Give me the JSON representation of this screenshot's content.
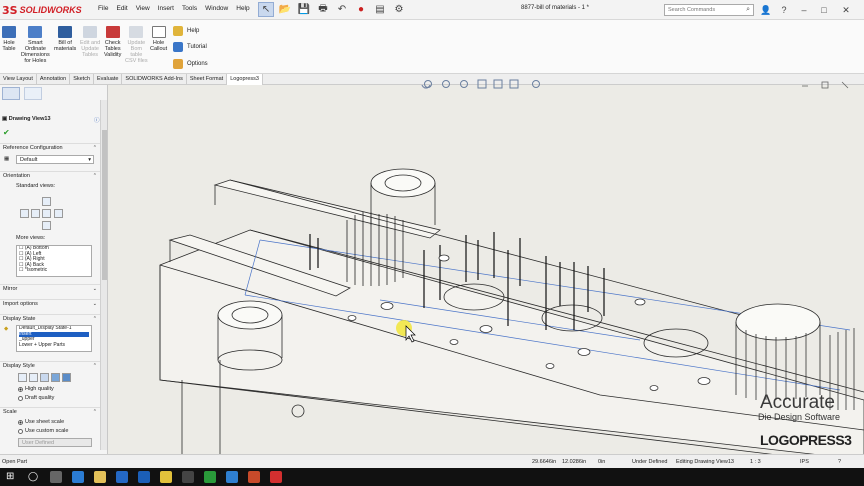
{
  "app": {
    "logo_mark": "3S",
    "logo_text": "SOLIDWORKS",
    "doc_title": "8877-bill of materials - 1 *"
  },
  "menu": [
    "File",
    "Edit",
    "View",
    "Insert",
    "Tools",
    "Window",
    "Help"
  ],
  "search": {
    "placeholder": "Search Commands"
  },
  "ribbon": {
    "buttons": [
      {
        "label": "Hole\nTable",
        "enabled": true
      },
      {
        "label": "Smart\nOrdinate\nDimensions\nfor Holes",
        "enabled": true
      },
      {
        "label": "Bill of\nmaterials",
        "enabled": true
      },
      {
        "label": "Edit and\nUpdate\nTables",
        "enabled": false
      },
      {
        "label": "Check\nTables\nValidity",
        "enabled": true
      },
      {
        "label": "Update\nBom\ntable\nCSV files",
        "enabled": false
      },
      {
        "label": "Hole\nCallout",
        "enabled": true
      }
    ],
    "side": [
      "Help",
      "Tutorial",
      "Options"
    ]
  },
  "tabs": [
    "View Layout",
    "Annotation",
    "Sketch",
    "Evaluate",
    "SOLIDWORKS Add-Ins",
    "Sheet Format",
    "Logopress3"
  ],
  "active_tab": "Logopress3",
  "panel": {
    "title": "Drawing View13",
    "ref_config": {
      "header": "Reference Configuration",
      "value": "Default"
    },
    "orientation": {
      "header": "Orientation",
      "standard_label": "Standard views:",
      "more_label": "More views:",
      "more_items": [
        "(A) Bottom",
        "(A) Left",
        "(A) Right",
        "(A) Back",
        "*Isometric"
      ]
    },
    "mirror": "Mirror",
    "import_options": "Import options",
    "display_state": {
      "header": "Display State",
      "items": [
        "Default_Display State-1",
        "Insert",
        "_upper",
        "Lower + Upper Parts"
      ]
    },
    "display_style": {
      "header": "Display Style",
      "options": [
        "High quality",
        "Draft quality"
      ]
    },
    "scale": {
      "header": "Scale",
      "options": [
        "Use sheet scale",
        "Use custom scale"
      ],
      "custom_value": "User Defined"
    }
  },
  "status": {
    "left": "Open Part",
    "x": "29.6646in",
    "y": "12.0286in",
    "z": "0in",
    "state": "Under Defined",
    "editing": "Editing Drawing View13",
    "scale": "1 : 3",
    "units": "IPS"
  },
  "watermark": {
    "line1": "Accurate",
    "line2": "Die Design Software",
    "brand": "LOGOPRESS3"
  },
  "colors": {
    "brand": "#d21f26",
    "selection": "#1e5fc2",
    "canvas": "#ecebe6",
    "sketch_line": "#4a74c8"
  }
}
